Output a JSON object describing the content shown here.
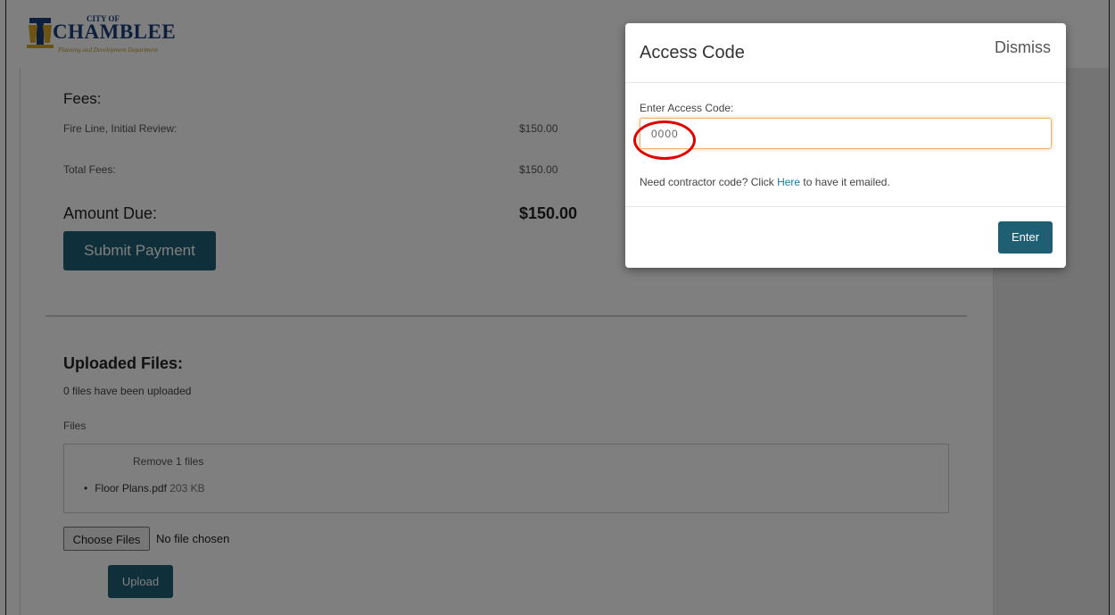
{
  "logo": {
    "small": "CITY OF",
    "name": "CHAMBLEE",
    "sub": "Planning and Development Department"
  },
  "fees": {
    "heading": "Fees:",
    "rows": [
      {
        "label": "Fire Line, Initial Review:",
        "amount": "$150.00"
      },
      {
        "label": "Total Fees:",
        "amount": "$150.00"
      }
    ],
    "amount_due_label": "Amount Due:",
    "amount_due_value": "$150.00",
    "submit_label": "Submit Payment"
  },
  "uploads": {
    "heading": "Uploaded Files:",
    "count_text": "0 files have been uploaded",
    "files_label": "Files",
    "remove_label": "Remove 1 files",
    "file_name": "Floor Plans.pdf",
    "file_size": "203 KB",
    "choose_label": "Choose Files",
    "no_file_text": "No file chosen",
    "upload_label": "Upload"
  },
  "modal": {
    "title": "Access Code",
    "dismiss_label": "Dismiss",
    "field_label": "Enter Access Code:",
    "input_placeholder": "0000",
    "contractor_prefix": "Need contractor code? Click ",
    "contractor_link": "Here",
    "contractor_suffix": " to have it emailed.",
    "enter_label": "Enter"
  },
  "colors": {
    "primary_button": "#1f5f74",
    "link": "#1f7a9a",
    "focus_border": "#f0b36a",
    "annotation_ring": "#e00000"
  }
}
